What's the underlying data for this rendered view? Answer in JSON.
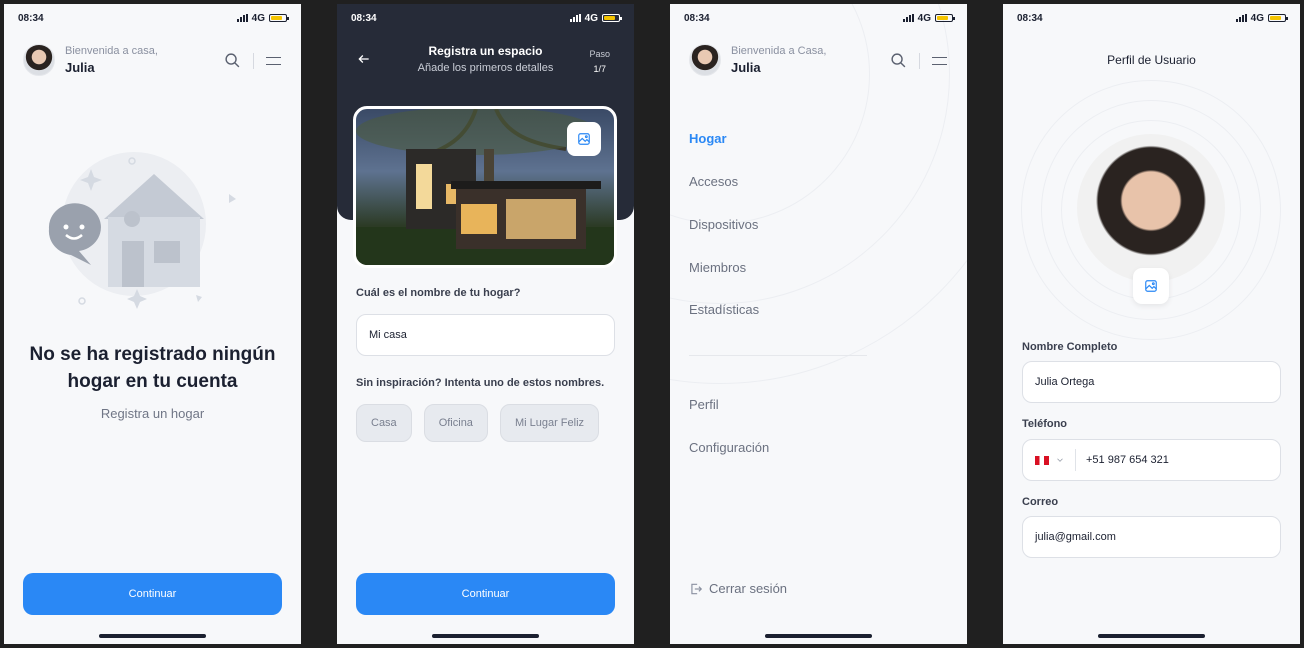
{
  "status": {
    "time": "08:34",
    "network": "4G"
  },
  "screen1": {
    "greeting": "Bienvenida a casa,",
    "user_name": "Julia",
    "empty_title_line1": "No se ha registrado ningún",
    "empty_title_line2": "hogar en tu cuenta",
    "empty_subtitle": "Registra un hogar",
    "button": "Continuar"
  },
  "screen2": {
    "title": "Registra un espacio",
    "subtitle": "Añade los primeros detalles",
    "step_label": "Paso",
    "step_value": "1/7",
    "question": "Cuál es el nombre de tu hogar?",
    "input_value": "Mi casa",
    "suggestion_label": "Sin inspiración? Intenta uno de estos nombres.",
    "chips": [
      "Casa",
      "Oficina",
      "Mi Lugar Feliz"
    ],
    "button": "Continuar"
  },
  "screen3": {
    "greeting": "Bienvenida a Casa,",
    "user_name": "Julia",
    "nav": [
      "Hogar",
      "Accesos",
      "Dispositivos",
      "Miembros",
      "Estadísticas"
    ],
    "secondary_nav": [
      "Perfil",
      "Configuración"
    ],
    "logout": "Cerrar sesión"
  },
  "screen4": {
    "title": "Perfil de Usuario",
    "name_label": "Nombre Completo",
    "name_value": "Julia Ortega",
    "phone_label": "Teléfono",
    "phone_value": "+51 987 654 321",
    "email_label": "Correo",
    "email_value": "julia@gmail.com"
  },
  "colors": {
    "accent": "#2a88f5",
    "dark_header": "#262b38"
  }
}
